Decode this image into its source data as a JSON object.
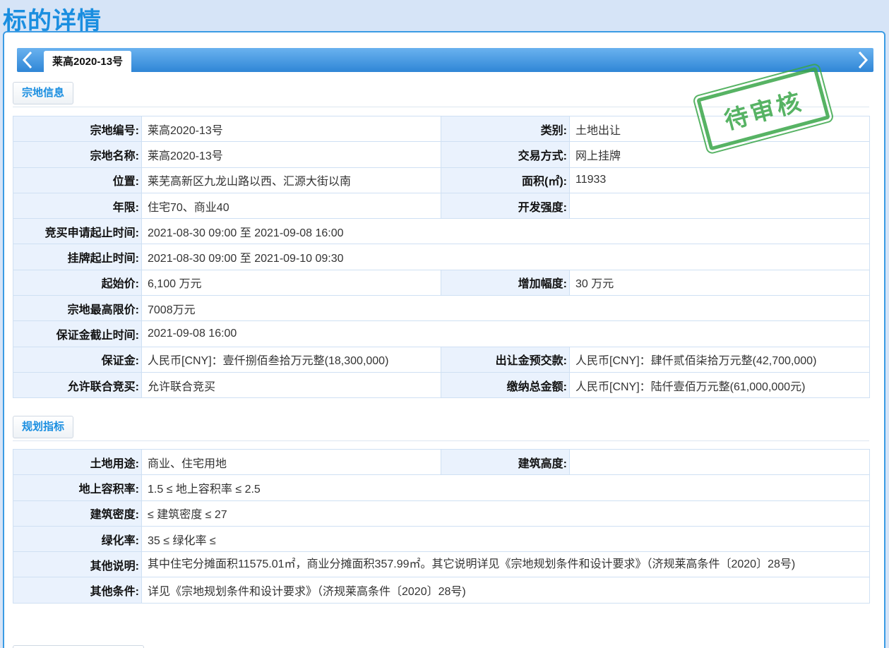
{
  "page": {
    "title": "标的详情"
  },
  "tab": {
    "label": "莱高2020-13号"
  },
  "stamp": {
    "text": "待审核",
    "color": "#3aa64a"
  },
  "colors": {
    "accent": "#1a8ee0",
    "label_bg": "#eaf2fd",
    "tabbar": "#3a8fdc"
  },
  "sections": {
    "parcel": {
      "title": "宗地信息",
      "rows": [
        {
          "l1": "宗地编号:",
          "v1": "莱高2020-13号",
          "l2": "类别:",
          "v2": "土地出让"
        },
        {
          "l1": "宗地名称:",
          "v1": "莱高2020-13号",
          "l2": "交易方式:",
          "v2": "网上挂牌"
        },
        {
          "l1": "位置:",
          "v1": "莱芜高新区九龙山路以西、汇源大街以南",
          "l2": "面积(㎡):",
          "v2": "11933"
        },
        {
          "l1": "年限:",
          "v1": "住宅70、商业40",
          "l2": "开发强度:",
          "v2": ""
        },
        {
          "l1": "竞买申请起止时间:",
          "v1": "2021-08-30 09:00 至 2021-09-08 16:00"
        },
        {
          "l1": "挂牌起止时间:",
          "v1": "2021-08-30 09:00 至 2021-09-10 09:30"
        },
        {
          "l1": "起始价:",
          "v1": "6,100 万元",
          "l2": "增加幅度:",
          "v2": "30 万元"
        },
        {
          "l1": "宗地最高限价:",
          "v1": "7008万元"
        },
        {
          "l1": "保证金截止时间:",
          "v1": "2021-09-08 16:00"
        },
        {
          "l1": "保证金:",
          "v1": "人民币[CNY]：壹仟捌佰叁拾万元整(18,300,000)",
          "l2": "出让金预交款:",
          "v2": "人民币[CNY]：肆仟贰佰柒拾万元整(42,700,000)"
        },
        {
          "l1": "允许联合竞买:",
          "v1": "允许联合竞买",
          "l2": "缴纳总金额:",
          "v2": "人民币[CNY]：陆仟壹佰万元整(61,000,000元)"
        }
      ]
    },
    "planning": {
      "title": "规划指标",
      "rows": [
        {
          "l1": "土地用途:",
          "v1": "商业、住宅用地",
          "l2": "建筑高度:",
          "v2": ""
        },
        {
          "l1": "地上容积率:",
          "v1": "1.5 ≤ 地上容积率 ≤ 2.5"
        },
        {
          "l1": "建筑密度:",
          "v1": "≤ 建筑密度 ≤ 27"
        },
        {
          "l1": "绿化率:",
          "v1": "35 ≤ 绿化率 ≤"
        },
        {
          "l1": "其他说明:",
          "v1": "其中住宅分摊面积11575.01㎡，商业分摊面积357.99㎡。其它说明详见《宗地规划条件和设计要求》（济规莱高条件〔2020〕28号)"
        },
        {
          "l1": "其他条件:",
          "v1": "详见《宗地规划条件和设计要求》（济规莱高条件〔2020〕28号)"
        }
      ]
    }
  }
}
